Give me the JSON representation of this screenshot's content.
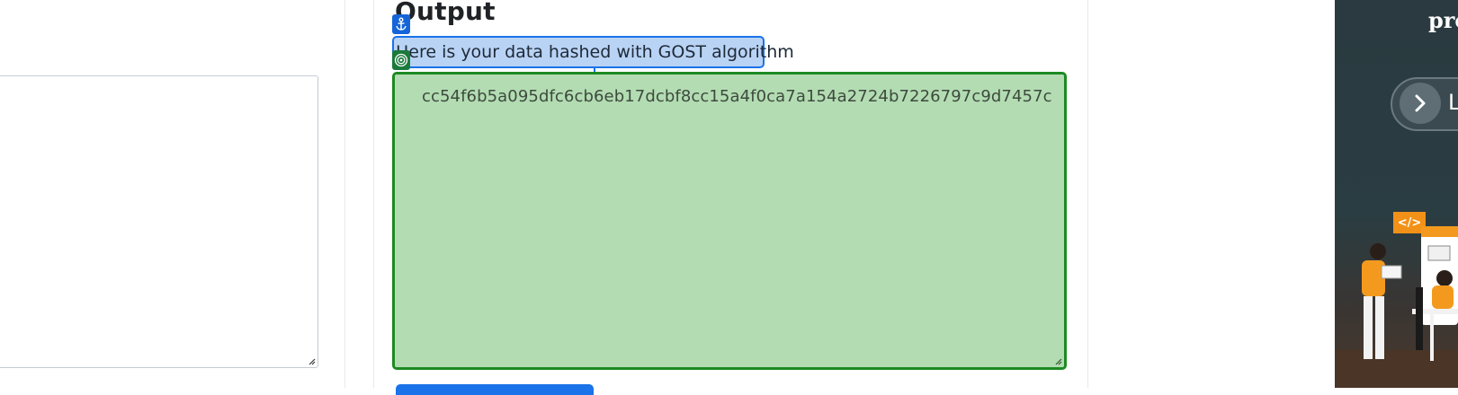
{
  "output": {
    "title": "Output",
    "subtitle": "Here is your data hashed with GOST algorithm",
    "hash_value": "cc54f6b5a095dfc6cb6eb17dcbf8cc15a4f0ca7a154a2724b7226797c9d7457c"
  },
  "ad": {
    "title_fragment": "pro",
    "button_letter": "L",
    "code_tag": "</>"
  },
  "colors": {
    "selection_blue": "#1a73e8",
    "output_green": "#1d8a22",
    "output_fill": "#b3dcb3"
  },
  "icons": {
    "anchor": "anchor-icon",
    "target": "target-icon",
    "chevron": "chevron-right-icon",
    "grip": "resize-grip-icon"
  }
}
